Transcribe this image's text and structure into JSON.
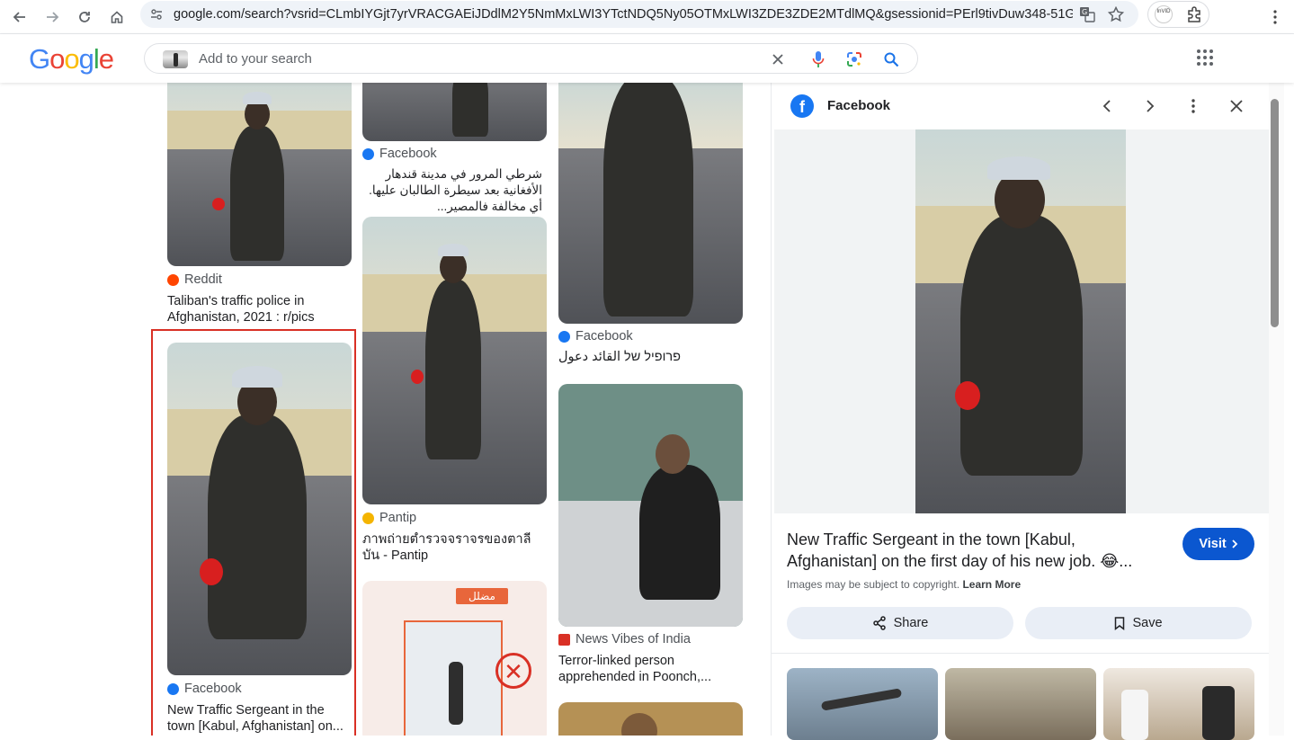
{
  "browser": {
    "url": "google.com/search?vsrid=CLmbIYGjt7yrVRACGAEiJDdlM2Y5NmMxLWI3YTctNDQ5Ny05OTMxLWI3ZDE3ZDE2MTdlMQ&gsessionid=PErl9tivDuw348-51G6bl7-hK...",
    "extension_label": "InVID"
  },
  "header": {
    "logo": [
      "G",
      "o",
      "o",
      "g",
      "l",
      "e"
    ],
    "logo_colors": [
      "#4285f4",
      "#ea4335",
      "#fbbc05",
      "#4285f4",
      "#34a853",
      "#ea4335"
    ],
    "search_placeholder": "Add to your search"
  },
  "results": [
    {
      "source": "Reddit",
      "title": "Taliban's traffic police in Afghanistan, 2021 : r/pics"
    },
    {
      "source": "Facebook",
      "title": "New Traffic Sergeant in the town [Kabul, Afghanistan] on..."
    },
    {
      "source": "Facebook",
      "title": "شرطي المرور في مدينة قندهار الأفغانية بعد سيطرة الطالبان عليها. أي مخالفة فالمصير..."
    },
    {
      "source": "Pantip",
      "title": "ภาพถ่ายตำรวจจราจรของตาลีบัน - Pantip"
    },
    {
      "source": "Facebook",
      "title": "פרופיל של القائد دعول"
    },
    {
      "source": "News Vibes of India",
      "title": "Terror-linked person apprehended in Poonch,..."
    }
  ],
  "thumb_text": {
    "badge": "مضلل"
  },
  "panel": {
    "source": "Facebook",
    "title": "New Traffic Sergeant in the town [Kabul, Afghanistan] on the first day of his new job. 😂...",
    "visit_label": "Visit",
    "copyright": "Images may be subject to copyright.",
    "learn_more": "Learn More",
    "share_label": "Share",
    "save_label": "Save"
  }
}
